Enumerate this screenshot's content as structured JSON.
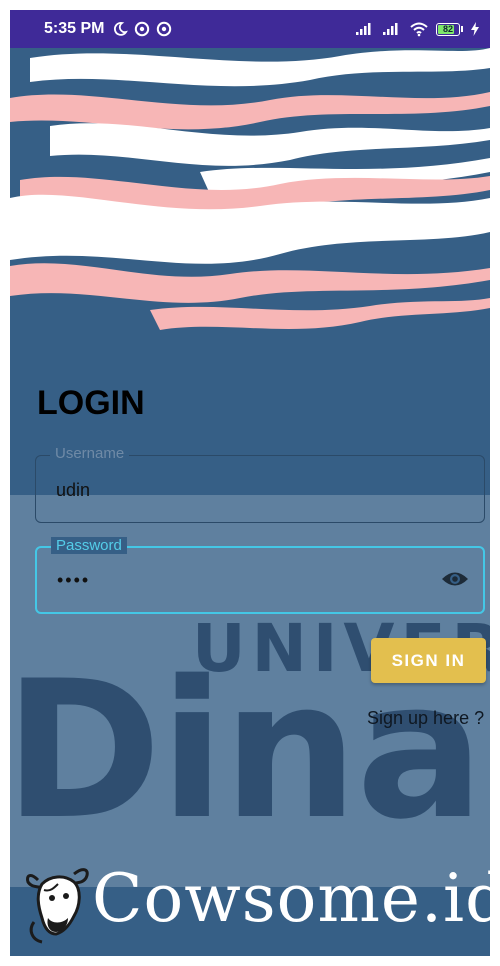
{
  "status_bar": {
    "time": "5:35 PM",
    "battery_level": "82",
    "icons": [
      "moon-icon",
      "dnd-icon",
      "dnd-icon",
      "signal-icon",
      "signal-icon",
      "wifi-icon",
      "battery-icon",
      "charging-icon"
    ]
  },
  "login": {
    "title": "LOGIN",
    "username_label": "Username",
    "username_value": "udin",
    "password_label": "Password",
    "password_value": "••••",
    "signin_label": "SIGN IN",
    "signup_link": "Sign up here ?"
  },
  "watermark": {
    "line1": "UNIVERS",
    "line2": "Dinar"
  },
  "brand": {
    "name": "Cowsome.id"
  },
  "colors": {
    "background": "#365f86",
    "status_bar": "#3f2a98",
    "accent_focus": "#44c7e6",
    "button": "#e3bf4e",
    "wave_pink": "#f7b6b6",
    "wave_white": "#ffffff"
  }
}
